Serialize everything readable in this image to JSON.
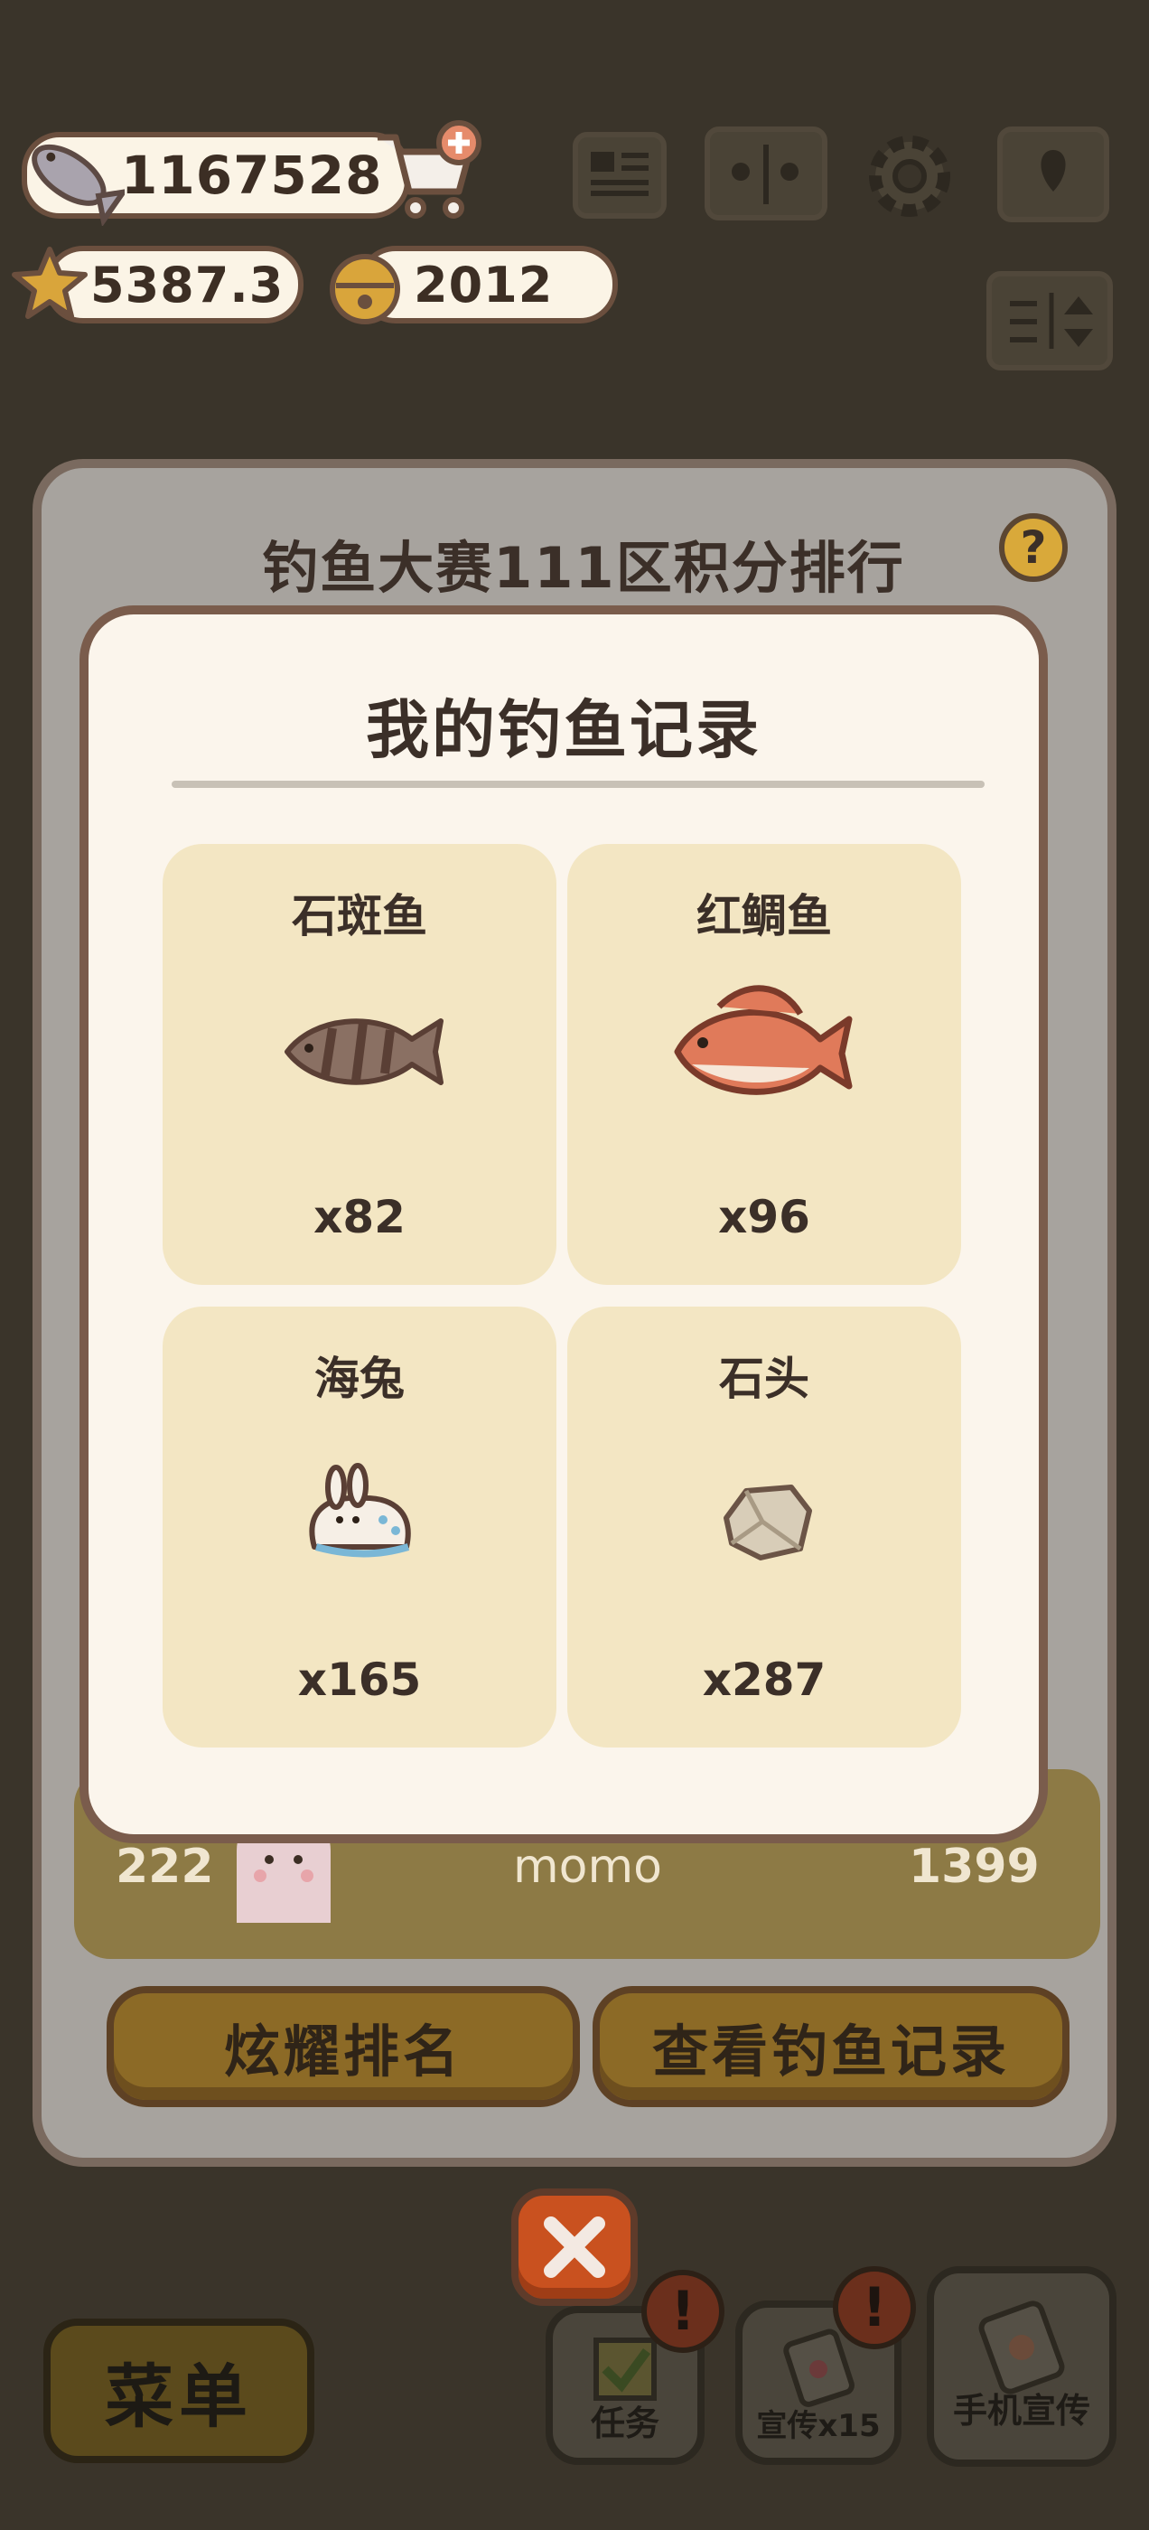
{
  "currencies": {
    "fish": "1167528",
    "stars": "5387.3",
    "bells": "2012"
  },
  "panel": {
    "title": "钓鱼大赛111区积分排行",
    "help_label": "?",
    "my_rank": {
      "rank": "222",
      "name": "momo",
      "score": "1399"
    },
    "buttons": {
      "share": "炫耀排名",
      "records": "查看钓鱼记录"
    }
  },
  "modal": {
    "title": "我的钓鱼记录",
    "items": [
      {
        "name": "石斑鱼",
        "count": "x82"
      },
      {
        "name": "红鲷鱼",
        "count": "x96"
      },
      {
        "name": "海兔",
        "count": "x165"
      },
      {
        "name": "石头",
        "count": "x287"
      }
    ]
  },
  "bottom": {
    "menu": "菜单",
    "tasks": "任务",
    "promo": "宣传x15",
    "phone_promo": "手机宣传",
    "alert": "!"
  }
}
